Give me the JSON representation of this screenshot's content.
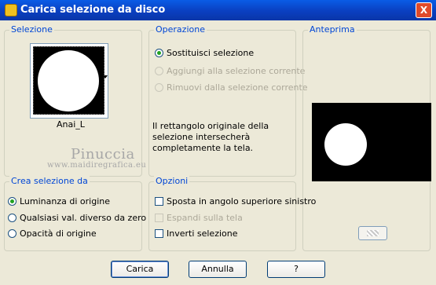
{
  "window": {
    "title": "Carica selezione da disco",
    "close_label": "X"
  },
  "selezione": {
    "label": "Selezione",
    "selected_name": "Anai_L"
  },
  "operazione": {
    "label": "Operazione",
    "options": [
      {
        "label": "Sostituisci selezione",
        "checked": true,
        "enabled": true
      },
      {
        "label": "Aggiungi alla selezione corrente",
        "checked": false,
        "enabled": false
      },
      {
        "label": "Rimuovi dalla selezione corrente",
        "checked": false,
        "enabled": false
      }
    ],
    "info": "Il rettangolo originale della selezione intersecherà completamente la tela."
  },
  "anteprima": {
    "label": "Anteprima"
  },
  "watermark": {
    "line1": "Pinuccia",
    "line2": "www.maidiregrafica.eu"
  },
  "crea": {
    "label": "Crea selezione da",
    "options": [
      {
        "label": "Luminanza di origine",
        "checked": true
      },
      {
        "label": "Qualsiasi val. diverso da zero",
        "checked": false
      },
      {
        "label": "Opacità di origine",
        "checked": false
      }
    ]
  },
  "opzioni": {
    "label": "Opzioni",
    "options": [
      {
        "label": "Sposta in angolo superiore sinistro",
        "checked": false,
        "enabled": true
      },
      {
        "label": "Espandi sulla tela",
        "checked": false,
        "enabled": false
      },
      {
        "label": "Inverti selezione",
        "checked": false,
        "enabled": true
      }
    ]
  },
  "buttons": {
    "load": "Carica",
    "cancel": "Annulla",
    "help": "?"
  },
  "icons": [
    "app-icon",
    "close-icon",
    "dropdown-arrow-icon",
    "preview-toggle-icon"
  ]
}
